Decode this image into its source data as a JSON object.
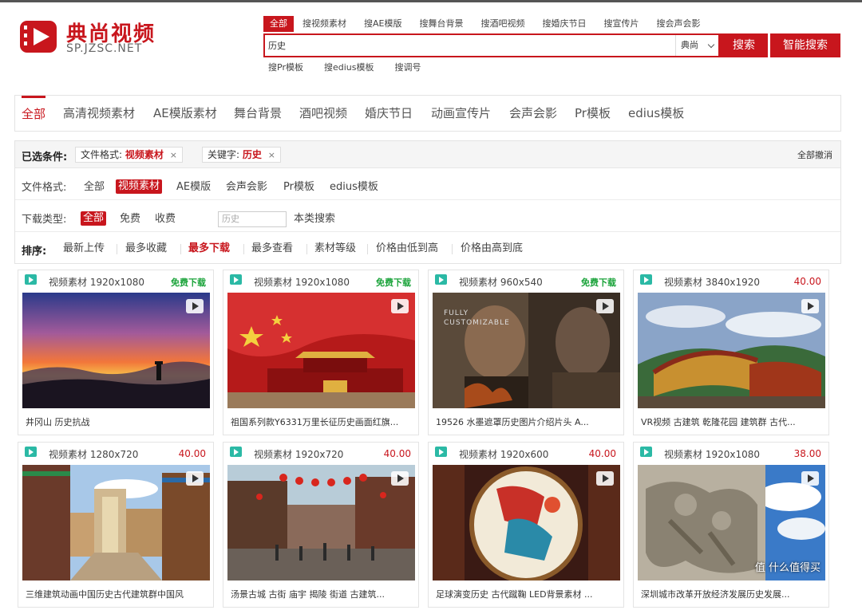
{
  "logo": {
    "cn": "典尚视频",
    "en": "SP.JZSC.NET"
  },
  "search": {
    "tabs": [
      "全部",
      "搜视频素材",
      "搜AE模版",
      "搜舞台背景",
      "搜酒吧视频",
      "搜婚庆节日",
      "搜宣传片",
      "搜会声会影"
    ],
    "value": "历史",
    "select": "典尚",
    "button": "搜索",
    "smart_button": "智能搜索",
    "sub_links": [
      "搜Pr模板",
      "搜edius模板",
      "搜调号"
    ]
  },
  "categories": [
    "全部",
    "高清视频素材",
    "AE模版素材",
    "舞台背景",
    "酒吧视频",
    "婚庆节日",
    "动画宣传片",
    "会声会影",
    "Pr模板",
    "edius模板"
  ],
  "filter": {
    "selected_label": "已选条件:",
    "chip1": {
      "key": "文件格式:",
      "value": "视频素材",
      "x": "×"
    },
    "chip2": {
      "key": "关键字:",
      "value": "历史",
      "x": "×"
    },
    "clear_all": "全部撤消",
    "format_label": "文件格式:",
    "format_options": [
      "全部",
      "视频素材",
      "AE模版",
      "会声会影",
      "Pr模板",
      "edius模板"
    ],
    "download_label": "下载类型:",
    "download_options": [
      "全部",
      "免费",
      "收费"
    ],
    "inner_search_placeholder": "历史",
    "inner_search_button": "本类搜索",
    "sort_label": "排序:",
    "sort_options": [
      "最新上传",
      "最多收藏",
      "最多下载",
      "最多查看",
      "素材等级",
      "价格由低到高",
      "价格由高到底"
    ]
  },
  "cards": [
    {
      "type": "视频素材 1920x1080",
      "price": "免费下载",
      "title": "井冈山 历史抗战"
    },
    {
      "type": "视频素材 1920x1080",
      "price": "免费下载",
      "title": "祖国系列款Y6331万里长征历史画面红旗..."
    },
    {
      "type": "视频素材 960x540",
      "price": "免费下载",
      "title": "19526 水墨遮罩历史图片介绍片头 A...",
      "overlay": "FULLY CUSTOMIZABLE"
    },
    {
      "type": "视频素材 3840x1920",
      "price": "40.00",
      "title": "VR视频 古建筑 乾隆花园 建筑群 古代..."
    },
    {
      "type": "视频素材 1280x720",
      "price": "40.00",
      "title": "三维建筑动画中国历史古代建筑群中国风"
    },
    {
      "type": "视频素材 1920x720",
      "price": "40.00",
      "title": "汤景古城 古街 庙宇 揭陵 街道 古建筑..."
    },
    {
      "type": "视频素材 1920x600",
      "price": "40.00",
      "title": "足球演变历史 古代蹴鞠 LED背景素材 ..."
    },
    {
      "type": "视频素材 1920x1080",
      "price": "38.00",
      "title": "深圳城市改革开放经济发展历史发展..."
    }
  ],
  "watermark": "值 什么值得买",
  "colors": {
    "brand": "#c8161d",
    "free": "#1aa33a",
    "video_icon": "#2bb9a5"
  }
}
